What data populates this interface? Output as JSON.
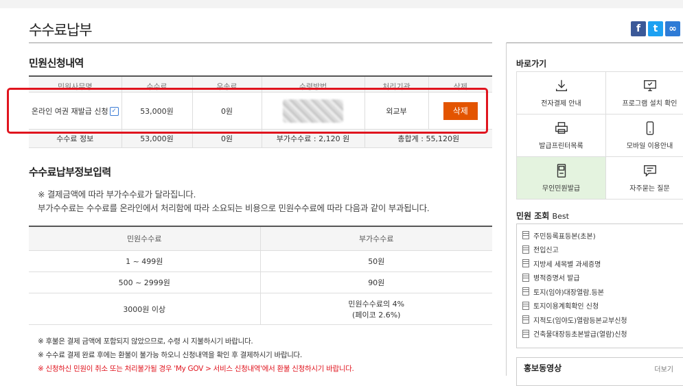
{
  "page": {
    "title": "수수료납부"
  },
  "share": {
    "facebook": "f",
    "twitter": "t",
    "link": "∞"
  },
  "request_section": {
    "title": "민원신청내역",
    "headers": [
      "민원사무명",
      "수수료",
      "우송료",
      "수령방법",
      "처리기관",
      "삭제"
    ],
    "row": {
      "name": "온라인 여권 재발급 신청",
      "fee": "53,000원",
      "postage": "0원",
      "agency": "외교부",
      "delete_label": "삭제"
    },
    "summary": {
      "label": "수수료 정보",
      "fee": "53,000원",
      "postage": "0원",
      "extra": "부가수수료 : 2,120 원",
      "total": "총합계 : 55,120원"
    }
  },
  "fee_section": {
    "title": "수수료납부정보입력",
    "notice1": "※ 결제금액에 따라 부가수수료가 달라집니다.",
    "notice2": "부가수수료는 수수료를 온라인에서 처리함에 따라 소요되는 비용으로 민원수수료에 따라 다음과 같이 부과됩니다.",
    "headers": [
      "민원수수료",
      "부가수수료"
    ],
    "rows": [
      {
        "range": "1 ~ 499원",
        "extra": "50원"
      },
      {
        "range": "500 ~ 2999원",
        "extra": "90원"
      },
      {
        "range": "3000원 이상",
        "extra": "민원수수료의 4%",
        "extra2": "(페이코 2.6%)"
      }
    ]
  },
  "footnotes": [
    "※ 후불은 결제 금액에 포함되지 않았으므로, 수령 시 지불하시기 바랍니다.",
    "※ 수수료 결제 완료 후에는 환불이 불가능 하오니 신청내역을 확인 후 결제하시기 바랍니다.",
    "※ 신청하신 민원이 취소 또는 처리불가될 경우 'My GOV > 서비스 신청내역'에서 환불 신청하시기 바랍니다."
  ],
  "sidebar": {
    "quick_title": "바로가기",
    "quick": [
      {
        "label": "전자결제 안내",
        "icon": "download-icon"
      },
      {
        "label": "프로그램 설치 확인",
        "icon": "monitor-icon"
      },
      {
        "label": "발급프린터목록",
        "icon": "printer-icon"
      },
      {
        "label": "모바일 이용안내",
        "icon": "mobile-icon"
      },
      {
        "label": "무인민원발급",
        "icon": "kiosk-icon"
      },
      {
        "label": "자주묻는 질문",
        "icon": "chat-icon"
      }
    ],
    "best_title": "민원 조회",
    "best_suffix": "Best",
    "best_items": [
      "주민등록표등본(초본)",
      "전입신고",
      "지방세 세목별 과세증명",
      "병적증명서 발급",
      "토지(임야)대장열람.등본",
      "토지이용계획확인 신청",
      "지적도(임야도)열람등본교부신청",
      "건축물대장등초본발급(열람)신청"
    ],
    "promo_title": "홍보동영상",
    "promo_more": "더보기"
  },
  "colors": {
    "delete": "#e35400",
    "highlight": "#e0141e",
    "notice_red": "#e0141e",
    "kiosk_bg": "#e4f3df"
  }
}
